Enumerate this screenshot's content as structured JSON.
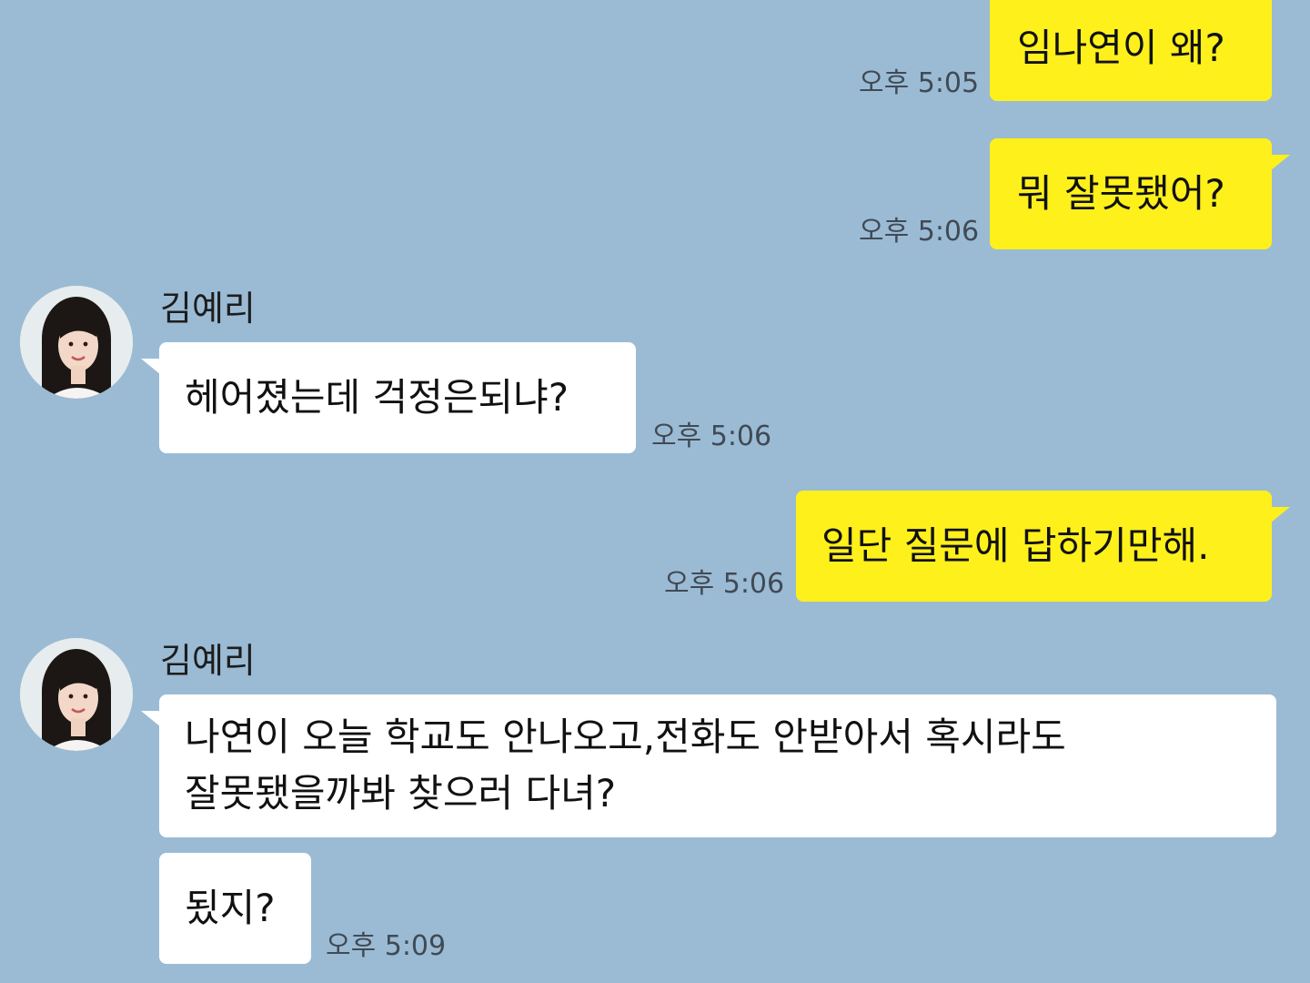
{
  "colors": {
    "background": "#9bbbd4",
    "my_bubble": "#fef01b",
    "their_bubble": "#ffffff"
  },
  "messages": [
    {
      "sender": "me",
      "text": "임나연이 왜?",
      "time": "오후 5:05"
    },
    {
      "sender": "me",
      "text": "뭐 잘못됐어?",
      "time": "오후 5:06"
    },
    {
      "sender": "김예리",
      "text": "헤어졌는데 걱정은되냐?",
      "time": "오후 5:06",
      "avatar": "profile-photo"
    },
    {
      "sender": "me",
      "text": "일단 질문에 답하기만해.",
      "time": "오후 5:06"
    },
    {
      "sender": "김예리",
      "text_line1": "나연이 오늘 학교도 안나오고,전화도 안받아서 혹시라도",
      "text_line2": "잘못됐을까봐 찾으러 다녀?",
      "avatar": "profile-photo"
    },
    {
      "sender": "김예리",
      "text": "됬지?",
      "time": "오후 5:09"
    }
  ]
}
